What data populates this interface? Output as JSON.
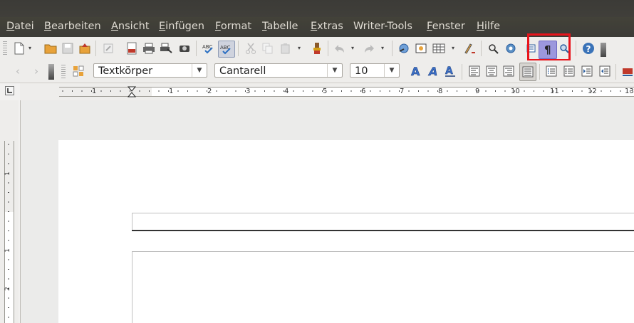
{
  "menubar": {
    "items": [
      {
        "u": "D",
        "rest": "atei"
      },
      {
        "u": "B",
        "rest": "earbeiten"
      },
      {
        "u": "A",
        "rest": "nsicht"
      },
      {
        "u": "E",
        "rest": "infügen"
      },
      {
        "u": "F",
        "rest": "ormat"
      },
      {
        "u": "T",
        "rest": "abelle"
      },
      {
        "u": "E",
        "rest": "xtras"
      },
      {
        "u": "",
        "rest": "Writer-Tools"
      },
      {
        "u": "F",
        "rest": "enster"
      },
      {
        "u": "H",
        "rest": "ilfe"
      }
    ]
  },
  "formatting": {
    "paragraph_style": "Textkörper",
    "font_name": "Cantarell",
    "font_size": "10"
  },
  "ruler": {
    "h_numbers": [
      "1",
      "1",
      "2",
      "3",
      "4",
      "5",
      "6",
      "7",
      "8",
      "9",
      "10",
      "11",
      "12",
      "13"
    ],
    "v_numbers": [
      "1",
      "1",
      "2"
    ]
  },
  "colors": {
    "highlight": "#e8141c",
    "menubar_bg": "#3c3b37",
    "toolbar_bg": "#eeedeb"
  }
}
